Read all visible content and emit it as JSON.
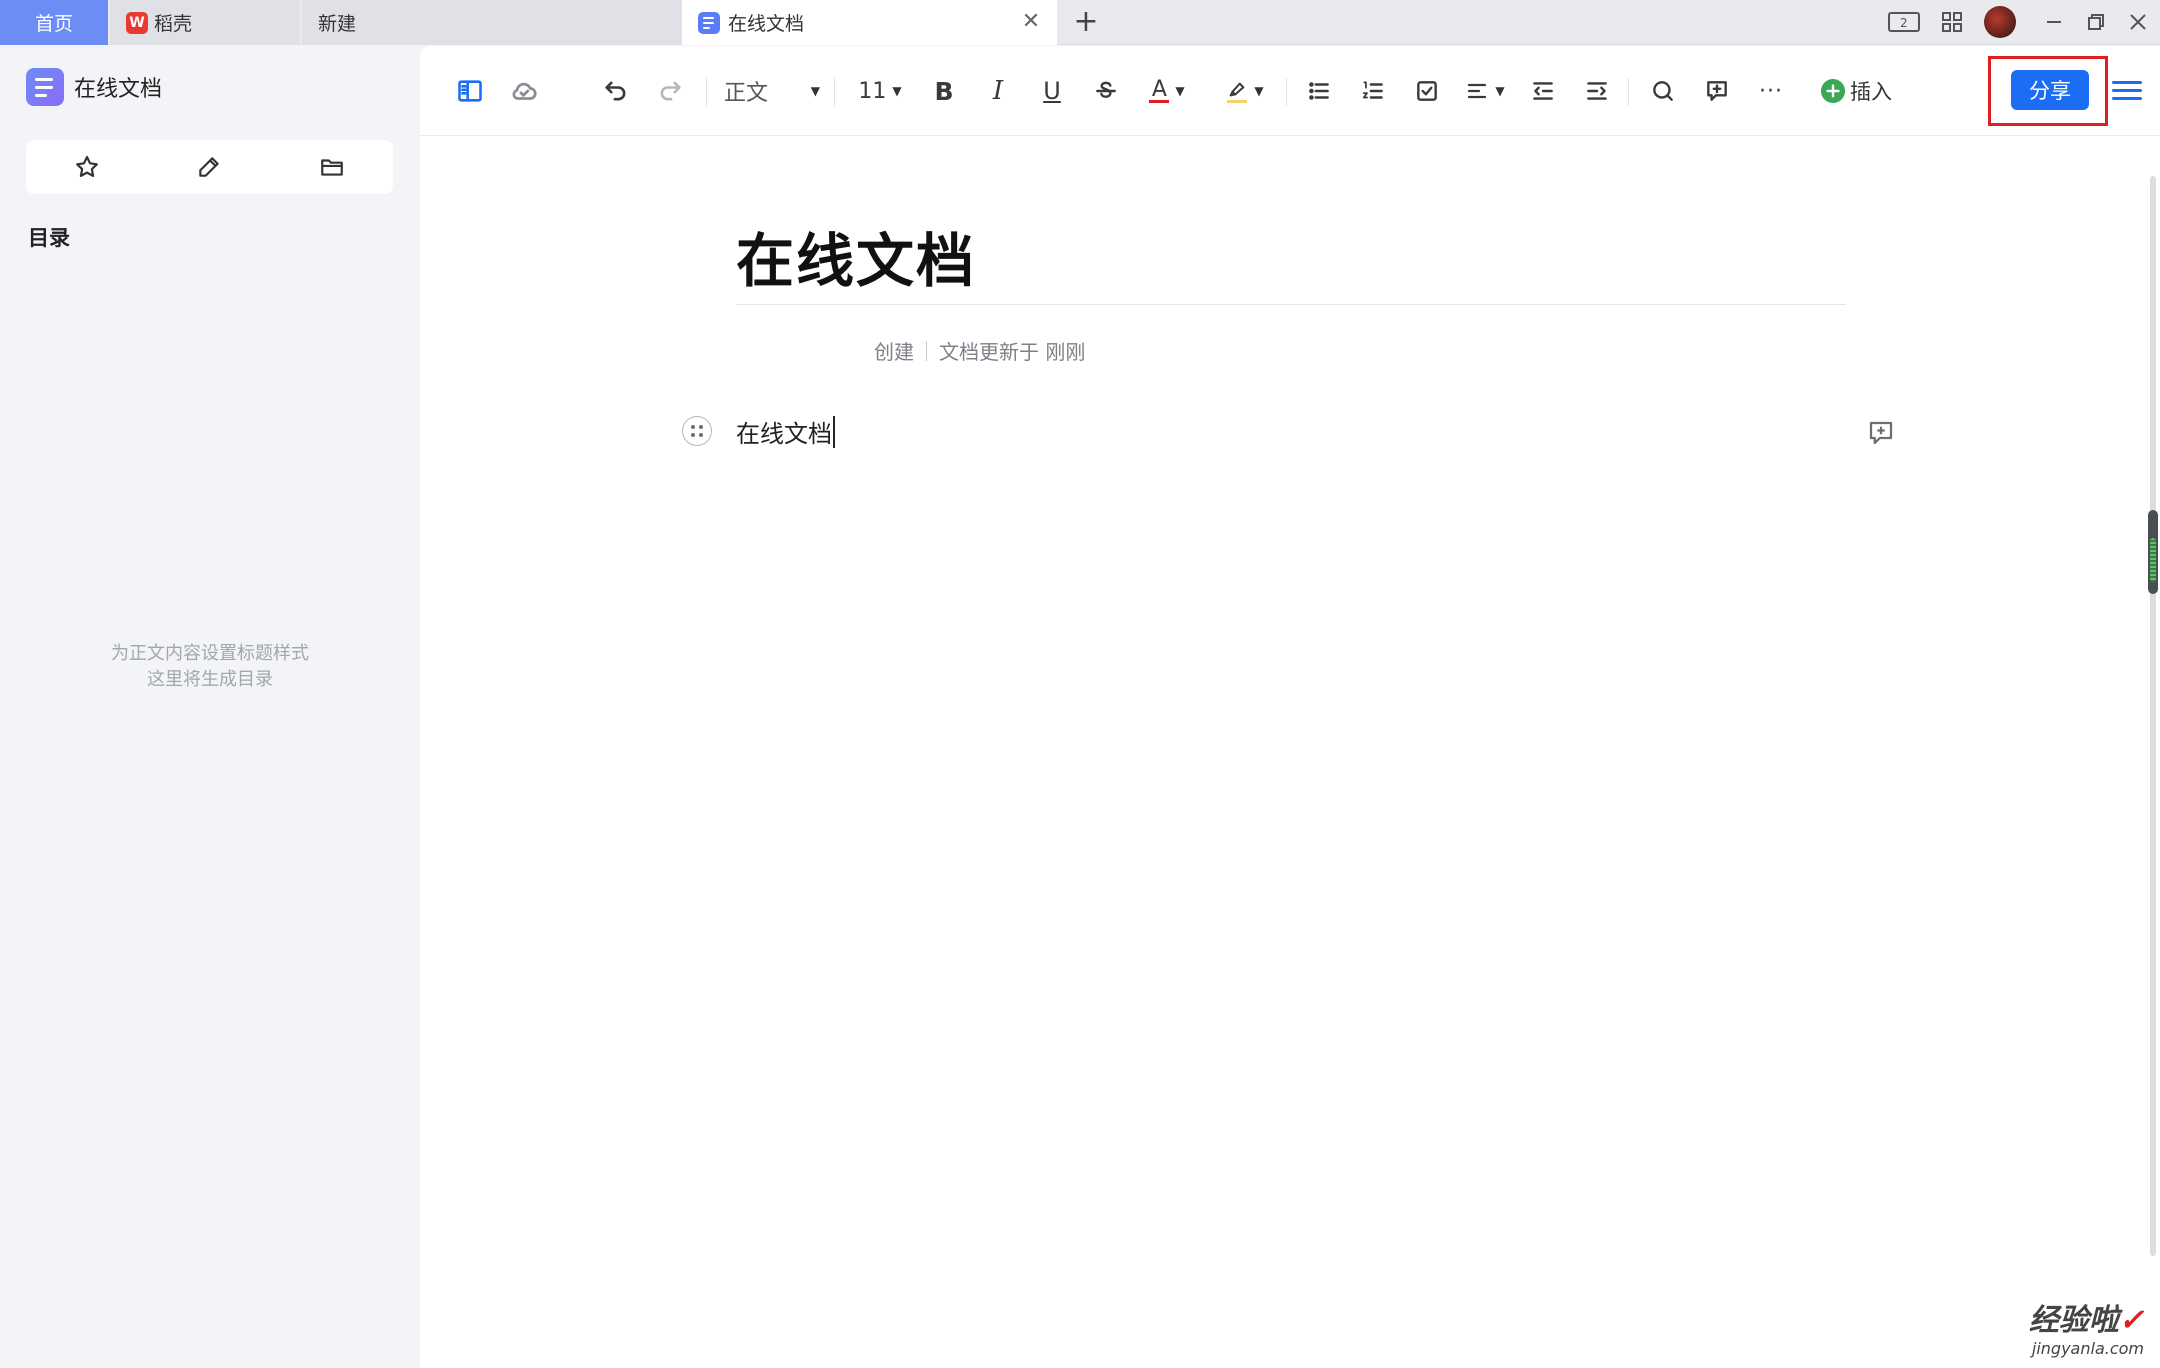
{
  "tabs": {
    "home": "首页",
    "daoke": "稻壳",
    "new": "新建",
    "active": "在线文档",
    "daoke_logo": "W"
  },
  "sidebar": {
    "title": "在线文档",
    "tools": [
      "star-icon",
      "pen-icon",
      "folder-icon"
    ],
    "toc_label": "目录",
    "toc_hint_line1": "为正文内容设置标题样式",
    "toc_hint_line2": "这里将生成目录"
  },
  "toolbar": {
    "style_value": "正文",
    "font_size": "11",
    "bold": "B",
    "italic": "I",
    "underline": "U",
    "font_color_label": "A",
    "more": "···",
    "insert_label": "插入",
    "share_label": "分享",
    "accent_color": "#1b6ef3",
    "highlight_box_color": "#e02020"
  },
  "document": {
    "title": "在线文档",
    "meta_created": "创建",
    "meta_updated": "文档更新于 刚刚",
    "body_text": "在线文档"
  },
  "watermark": {
    "line1": "经验啦",
    "check": "✓",
    "line2": "jingyanla.com"
  }
}
